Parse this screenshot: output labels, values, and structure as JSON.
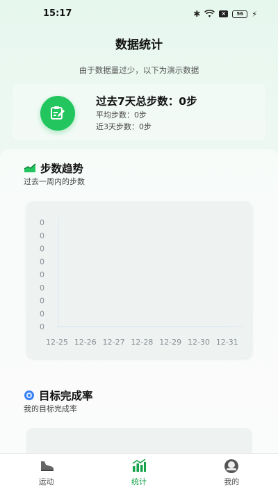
{
  "status_bar": {
    "time": "15:17",
    "icons": [
      "bluetooth-icon",
      "wifi-icon",
      "x-box-icon",
      "battery-icon",
      "charging-icon"
    ],
    "battery_text": "56"
  },
  "header": {
    "title": "数据统计",
    "notice": "由于数据量过少，以下为演示数据"
  },
  "summary": {
    "icon": "clipboard-edit-icon",
    "total": "过去7天总步数：0步",
    "average": "平均步数：0步",
    "recent3": "近3天步数：0步"
  },
  "trend_section": {
    "icon": "trend-chart-icon",
    "title": "步数趋势",
    "subtitle": "过去一周内的步数"
  },
  "goal_section": {
    "icon": "target-icon",
    "title": "目标完成率",
    "subtitle": "我的目标完成率"
  },
  "chart_data": {
    "type": "line",
    "categories": [
      "12-25",
      "12-26",
      "12-27",
      "12-28",
      "12-29",
      "12-30",
      "12-31"
    ],
    "values": [
      0,
      0,
      0,
      0,
      0,
      0,
      0
    ],
    "y_tick_labels": [
      "0",
      "0",
      "0",
      "0",
      "0",
      "0",
      "0",
      "0",
      "0"
    ],
    "title": "",
    "xlabel": "",
    "ylabel": "",
    "grid": false
  },
  "bottom_nav": {
    "items": [
      {
        "label": "运动",
        "icon": "sneaker-icon",
        "active": false
      },
      {
        "label": "统计",
        "icon": "bar-chart-icon",
        "active": true
      },
      {
        "label": "我的",
        "icon": "profile-icon",
        "active": false
      }
    ]
  },
  "colors": {
    "accent": "#22c55e",
    "active_nav": "#16a34a"
  }
}
